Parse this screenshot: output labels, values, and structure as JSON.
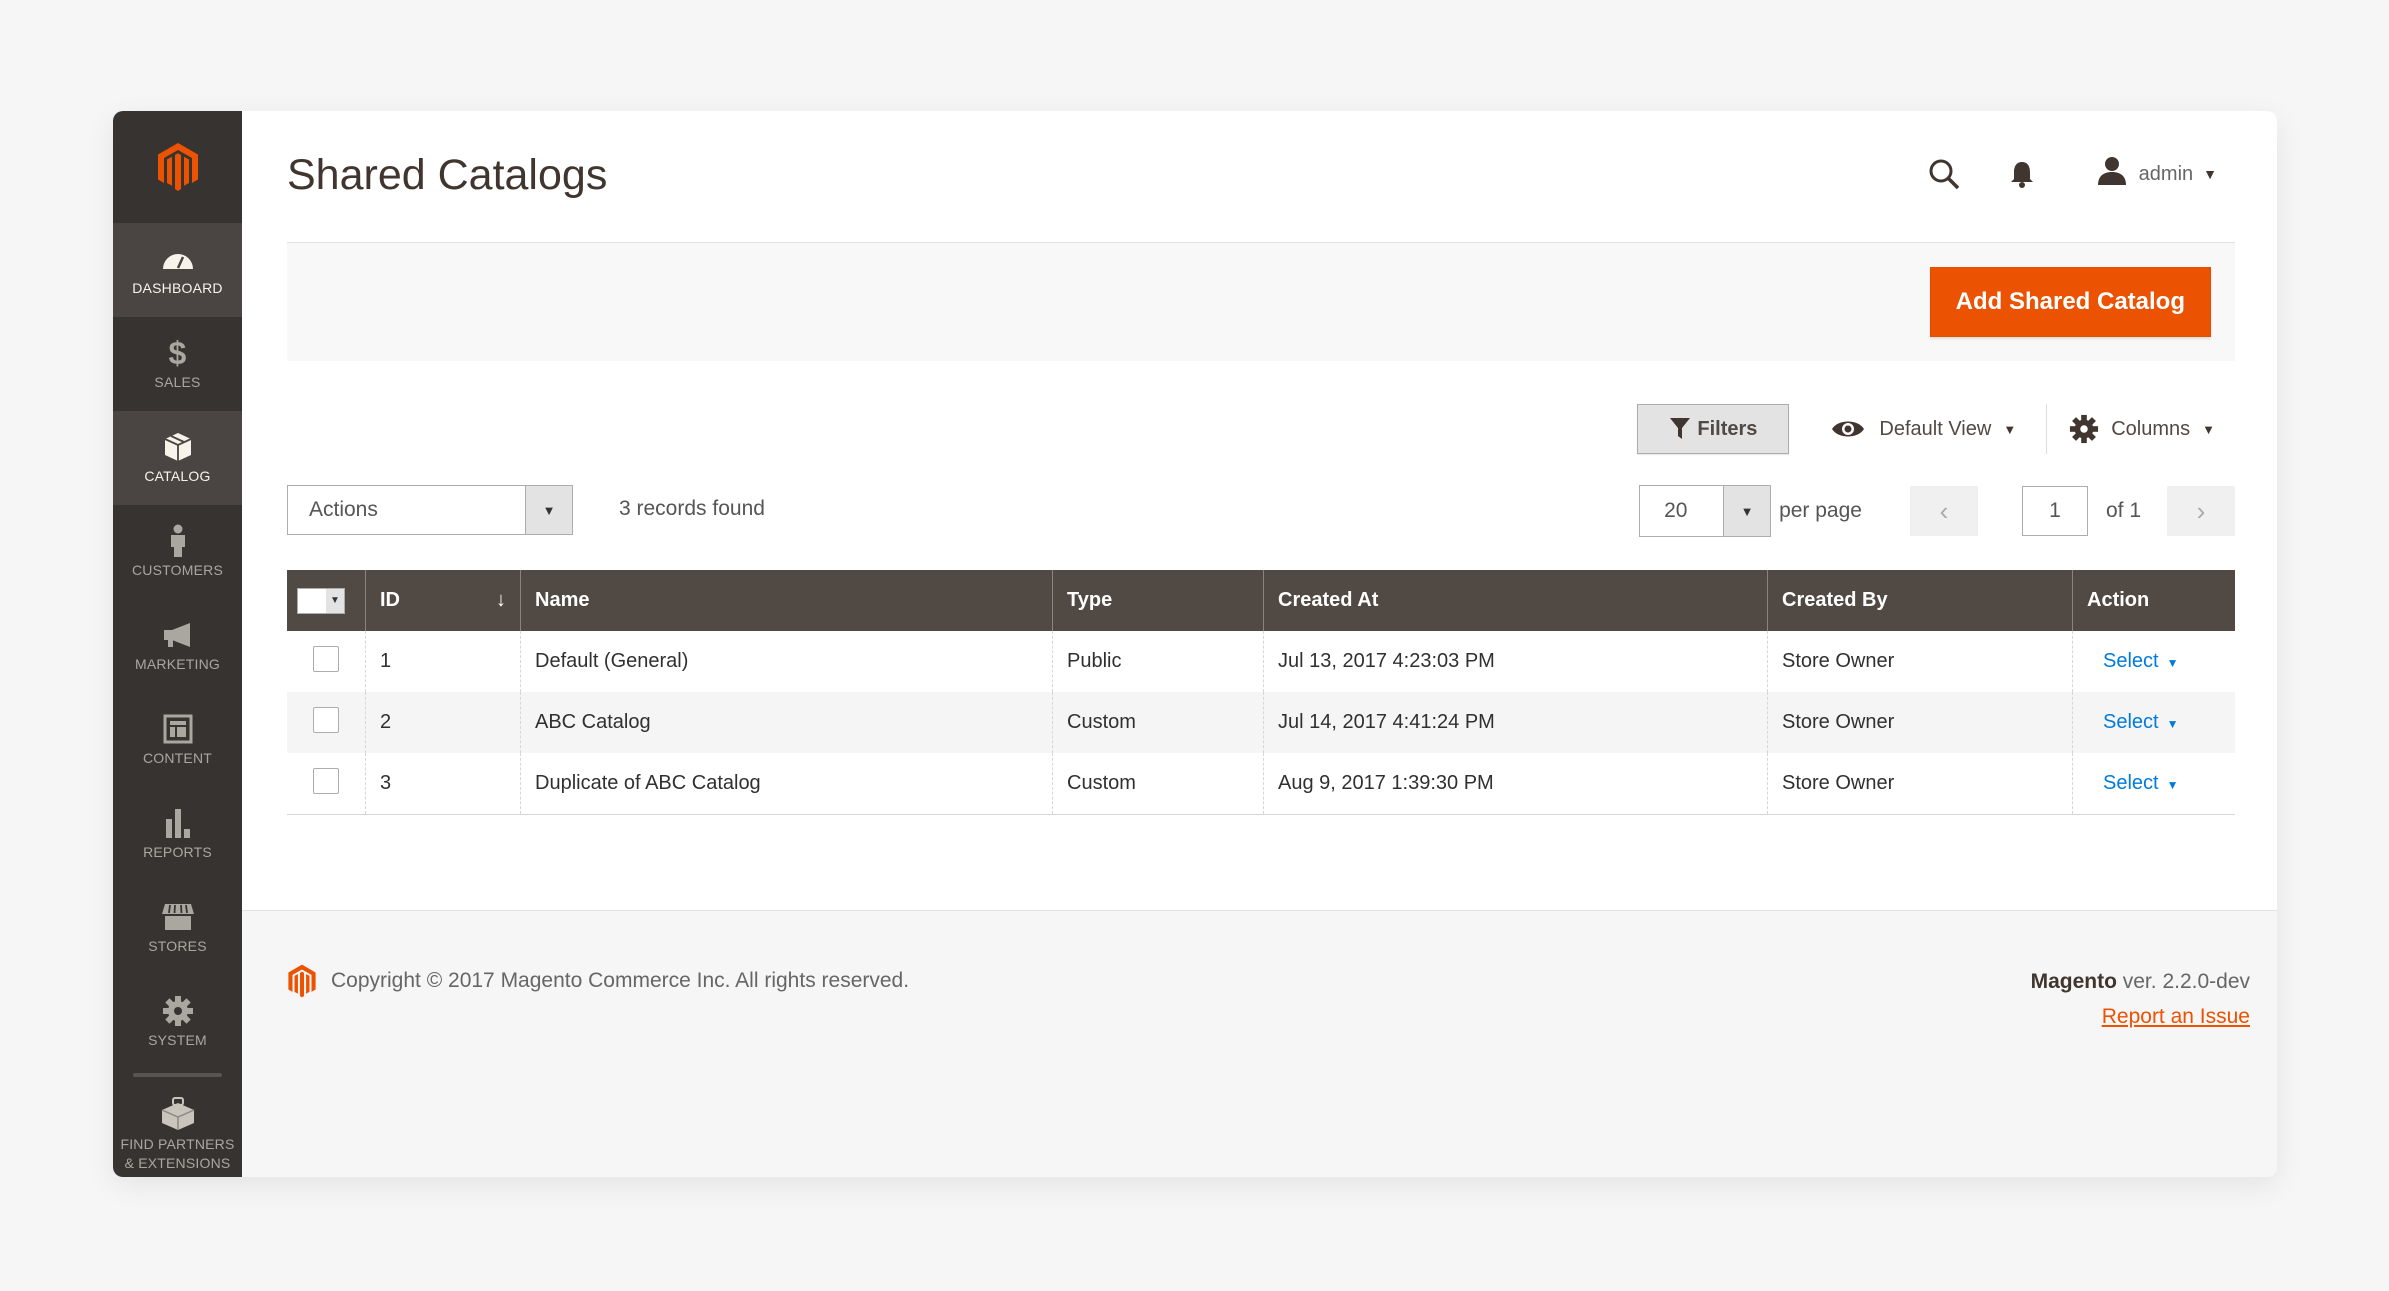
{
  "sidebar": {
    "logo": "magento-logo",
    "items": [
      {
        "label": "DASHBOARD",
        "icon": "dashboard-gauge-icon"
      },
      {
        "label": "SALES",
        "icon": "dollar-icon"
      },
      {
        "label": "CATALOG",
        "icon": "box-icon",
        "active": true
      },
      {
        "label": "CUSTOMERS",
        "icon": "person-icon"
      },
      {
        "label": "MARKETING",
        "icon": "megaphone-icon"
      },
      {
        "label": "CONTENT",
        "icon": "layout-icon"
      },
      {
        "label": "REPORTS",
        "icon": "bar-chart-icon"
      },
      {
        "label": "STORES",
        "icon": "storefront-icon"
      },
      {
        "label": "SYSTEM",
        "icon": "gear-icon"
      },
      {
        "label_line1": "FIND PARTNERS",
        "label_line2": "& EXTENSIONS",
        "icon": "partners-box-icon"
      }
    ]
  },
  "header": {
    "title": "Shared Catalogs",
    "user": "admin"
  },
  "actionbar": {
    "add_button": "Add Shared Catalog"
  },
  "toolbar": {
    "filters": "Filters",
    "view": "Default View",
    "columns": "Columns",
    "actions": "Actions",
    "records_found": "3 records found",
    "per_page_value": "20",
    "per_page_label": "per page",
    "current_page": "1",
    "total_pages_label": "of 1"
  },
  "grid": {
    "columns": [
      "ID",
      "Name",
      "Type",
      "Created At",
      "Created By",
      "Action"
    ],
    "rows": [
      {
        "id": "1",
        "name": "Default (General)",
        "type": "Public",
        "created_at": "Jul 13, 2017 4:23:03 PM",
        "created_by": "Store Owner",
        "action": "Select"
      },
      {
        "id": "2",
        "name": "ABC Catalog",
        "type": "Custom",
        "created_at": "Jul 14, 2017 4:41:24 PM",
        "created_by": "Store Owner",
        "action": "Select"
      },
      {
        "id": "3",
        "name": "Duplicate of ABC Catalog",
        "type": "Custom",
        "created_at": "Aug 9, 2017 1:39:30 PM",
        "created_by": "Store Owner",
        "action": "Select"
      }
    ]
  },
  "footer": {
    "copyright": "Copyright © 2017 Magento Commerce Inc. All rights reserved.",
    "brand": "Magento",
    "version": " ver. 2.2.0-dev",
    "report_link": "Report an Issue"
  },
  "colors": {
    "accent": "#eb5202",
    "sidebar_bg": "#373330",
    "grid_header_bg": "#514943",
    "link": "#007bdb"
  }
}
